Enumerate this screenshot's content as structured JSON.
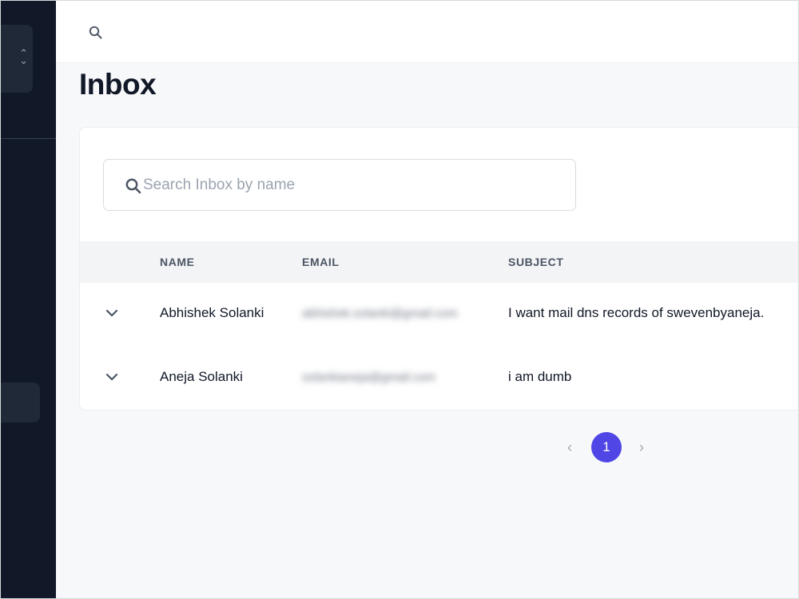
{
  "page": {
    "title": "Inbox"
  },
  "search": {
    "placeholder": "Search Inbox by name",
    "value": ""
  },
  "table": {
    "columns": [
      "NAME",
      "EMAIL",
      "SUBJECT"
    ],
    "rows": [
      {
        "name": "Abhishek Solanki",
        "email": "abhishek.solanki@gmail.com",
        "subject": "I want mail dns records of swevenbyaneja."
      },
      {
        "name": "Aneja Solanki",
        "email": "solankianeja@gmail.com",
        "subject": "i am dumb"
      }
    ]
  },
  "pagination": {
    "current_page": "1",
    "prev_icon": "chevron-left-icon",
    "next_icon": "chevron-right-icon"
  },
  "icons": {
    "topbar_search": "search-icon",
    "row_expand": "chevron-down-icon",
    "workspace_switcher": "chevron-up-down-icon"
  },
  "colors": {
    "sidebar_bg": "#111827",
    "accent": "#4f46e5",
    "page_bg": "#f7f8fa"
  }
}
